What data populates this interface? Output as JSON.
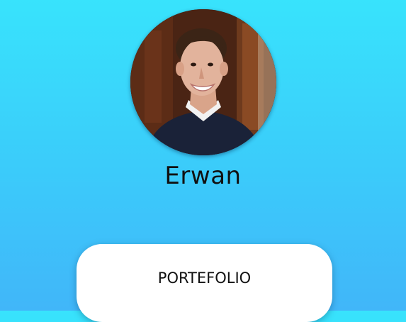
{
  "profile": {
    "photo_alt": "Erwan",
    "name": "Erwan"
  },
  "actions": {
    "portfolio_label": "PORTEFOLIO"
  },
  "colors": {
    "background_top": "#38e3fc",
    "background_bottom": "#41b6f9",
    "button_background": "#ffffff",
    "text": "#111111"
  }
}
